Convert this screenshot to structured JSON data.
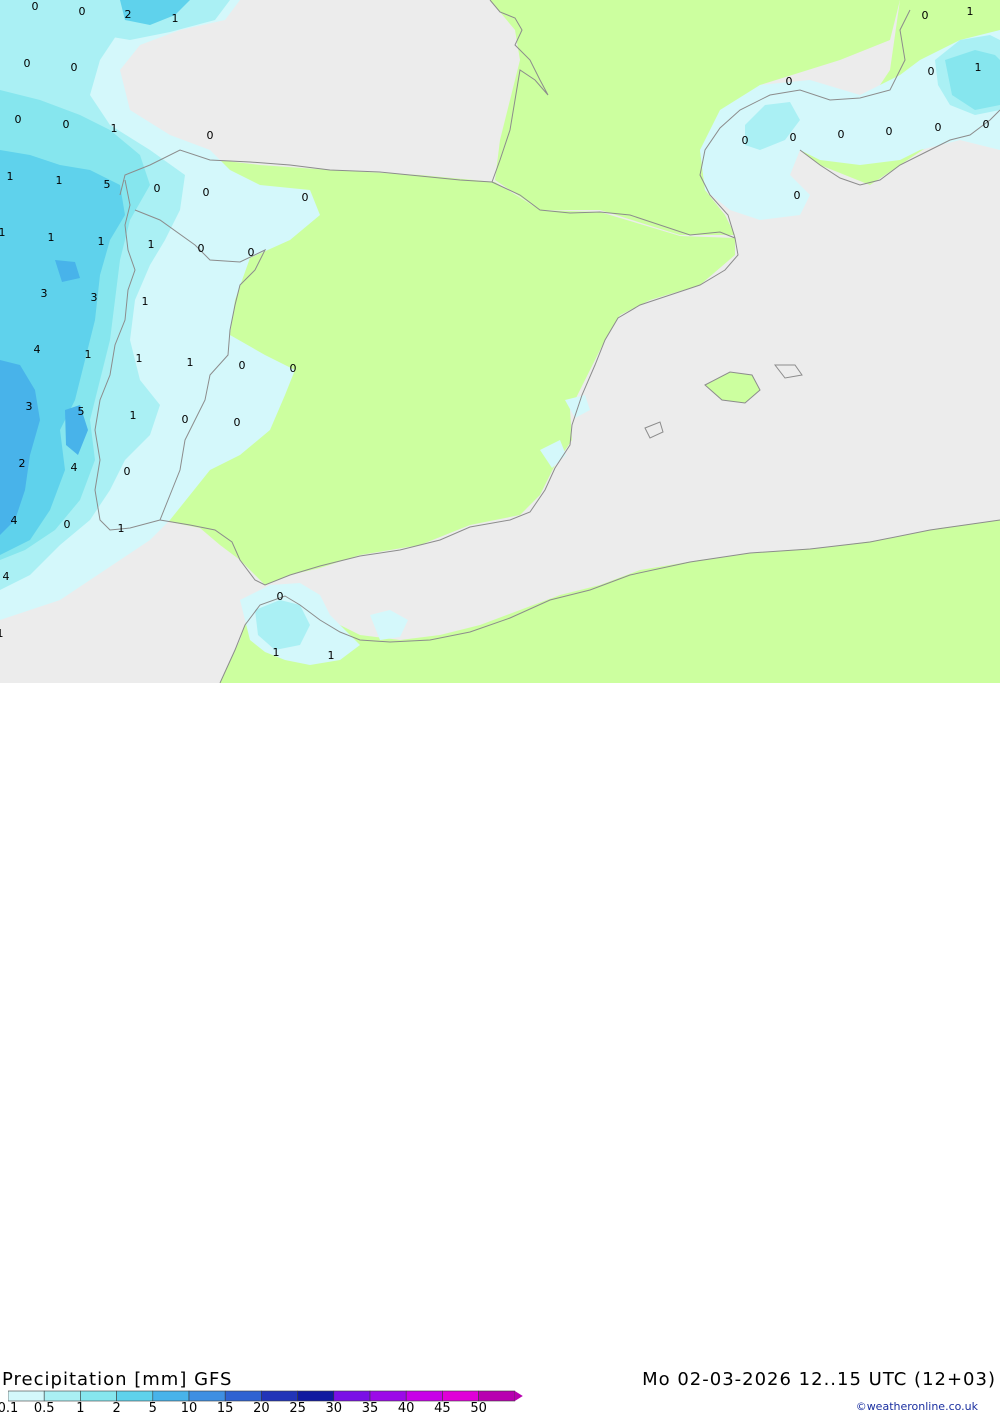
{
  "map": {
    "colors": {
      "sea": "#ececec",
      "land": "#ccff9f",
      "precip_0_1": "#d4f8fb",
      "precip_0_5": "#aaf0f4",
      "precip_1": "#86e6ee",
      "precip_2": "#5fd2ec",
      "precip_5": "#48b3ea",
      "border": "#8c8c8c"
    },
    "value_labels": [
      {
        "text": "0"
      },
      {
        "text": "0"
      },
      {
        "text": "2"
      },
      {
        "text": "1"
      },
      {
        "text": "0"
      },
      {
        "text": "0"
      },
      {
        "text": "0"
      },
      {
        "text": "0"
      },
      {
        "text": "1"
      },
      {
        "text": "0"
      },
      {
        "text": "1"
      },
      {
        "text": "1"
      },
      {
        "text": "5"
      },
      {
        "text": "0"
      },
      {
        "text": "0"
      },
      {
        "text": "0"
      },
      {
        "text": "1"
      },
      {
        "text": "1"
      },
      {
        "text": "1"
      },
      {
        "text": "1"
      },
      {
        "text": "0"
      },
      {
        "text": "0"
      },
      {
        "text": "3"
      },
      {
        "text": "3"
      },
      {
        "text": "1"
      },
      {
        "text": "4"
      },
      {
        "text": "1"
      },
      {
        "text": "1"
      },
      {
        "text": "1"
      },
      {
        "text": "0"
      },
      {
        "text": "0"
      },
      {
        "text": "3"
      },
      {
        "text": "5"
      },
      {
        "text": "1"
      },
      {
        "text": "0"
      },
      {
        "text": "0"
      },
      {
        "text": "2"
      },
      {
        "text": "4"
      },
      {
        "text": "0"
      },
      {
        "text": "4"
      },
      {
        "text": "0"
      },
      {
        "text": "1"
      },
      {
        "text": "4"
      },
      {
        "text": "0"
      },
      {
        "text": "1"
      },
      {
        "text": "1"
      },
      {
        "text": "1"
      },
      {
        "text": "0"
      },
      {
        "text": "1"
      },
      {
        "text": "0"
      },
      {
        "text": "1"
      },
      {
        "text": "0"
      },
      {
        "text": "0"
      },
      {
        "text": "0"
      },
      {
        "text": "0"
      },
      {
        "text": "0"
      },
      {
        "text": "0"
      },
      {
        "text": "0"
      }
    ]
  },
  "footer": {
    "title_left": "Precipitation [mm] GFS",
    "title_right": "Mo 02-03-2026 12..15 UTC (12+03)",
    "credit": "©weatheronline.co.uk",
    "scale": [
      {
        "label": "0.1",
        "color": "#d4f8fb"
      },
      {
        "label": "0.5",
        "color": "#aaf0f4"
      },
      {
        "label": "1",
        "color": "#86e6ee"
      },
      {
        "label": "2",
        "color": "#5fd2ec"
      },
      {
        "label": "5",
        "color": "#48b3ea"
      },
      {
        "label": "10",
        "color": "#3f8fe2"
      },
      {
        "label": "15",
        "color": "#2f62d2"
      },
      {
        "label": "20",
        "color": "#2234b8"
      },
      {
        "label": "25",
        "color": "#101aa0"
      },
      {
        "label": "30",
        "color": "#7a10e6"
      },
      {
        "label": "35",
        "color": "#9c0ae8"
      },
      {
        "label": "40",
        "color": "#c800e8"
      },
      {
        "label": "45",
        "color": "#e000d8"
      },
      {
        "label": "50",
        "color": "#b800b0"
      }
    ]
  }
}
